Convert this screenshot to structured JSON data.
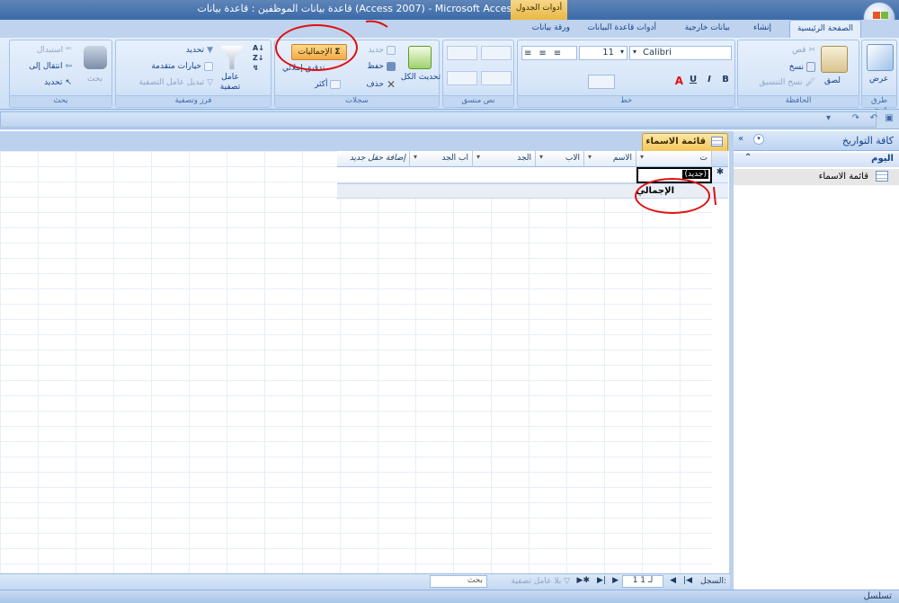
{
  "window": {
    "title": "قاعدة بيانات الموظفين : قاعدة بيانات (Access 2007) - Microsoft Access",
    "context_tab": "أدوات الجدول"
  },
  "ribbon_tabs": [
    {
      "label": "الصفحة الرئيسية",
      "active": true
    },
    {
      "label": "إنشاء",
      "active": false
    },
    {
      "label": "بيانات خارجية",
      "active": false
    },
    {
      "label": "أدوات قاعدة البيانات",
      "active": false
    },
    {
      "label": "ورقة بيانات",
      "active": false
    }
  ],
  "groups": {
    "views": {
      "label": "طرق عرض",
      "view_button": "عرض"
    },
    "clipboard": {
      "label": "الحافظة",
      "paste": "لصق",
      "cut": "قص",
      "copy": "نسخ",
      "format_painter": "نسخ التنسيق"
    },
    "font": {
      "label": "خط",
      "font_name": "Calibri",
      "font_size": "11",
      "bold": "B",
      "italic": "I",
      "underline": "U"
    },
    "rich_text": {
      "label": "نص منسق"
    },
    "records": {
      "label": "سجلات",
      "refresh_all": "تحديث الكل",
      "new": "جديد",
      "save": "حفظ",
      "delete": "حذف",
      "totals": "الإجماليات",
      "spelling": "تدقيق إملائي",
      "more": "أكثر"
    },
    "sort_filter": {
      "label": "فرز وتصفية",
      "filter": "عامل تصفية",
      "selection": "تحديد",
      "advanced": "خيارات متقدمة",
      "toggle_filter": "تبديل عامل التصفية"
    },
    "find": {
      "label": "بحث",
      "find": "بحث",
      "replace": "استبدال",
      "goto": "انتقال إلى",
      "select": "تحديد"
    }
  },
  "nav_pane": {
    "header": "كافة التواريخ",
    "section": "اليوم",
    "items": [
      {
        "label": "قائمة الاسماء"
      }
    ]
  },
  "document": {
    "tab_label": "قائمة الاسماء",
    "columns": [
      {
        "label": "ت"
      },
      {
        "label": "الاسم"
      },
      {
        "label": "الاب"
      },
      {
        "label": "الجد"
      },
      {
        "label": "اب الجد"
      },
      {
        "label": "إضافة حقل جديد"
      }
    ],
    "new_row_value": "(جديد)",
    "total_row_label": "الإجمالي"
  },
  "record_nav": {
    "label": "السجل:",
    "position": "1 لـ 1",
    "no_filter": "بلا عامل تصفية",
    "search_placeholder": "بحث"
  },
  "status_bar": {
    "text": "تسلسل"
  }
}
